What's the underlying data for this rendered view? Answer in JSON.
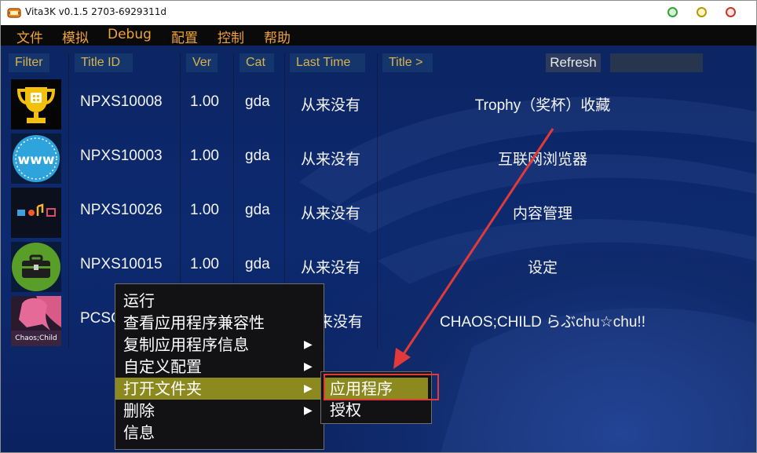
{
  "window": {
    "title": "Vita3K v0.1.5 2703-6929311d"
  },
  "menu": [
    "文件",
    "模拟",
    "Debug",
    "配置",
    "控制",
    "帮助"
  ],
  "columns": {
    "filter": "Filter",
    "title_id": "Title ID",
    "ver": "Ver",
    "cat": "Cat",
    "last_time": "Last Time",
    "title": "Title >",
    "refresh": "Refresh"
  },
  "search": {
    "value": ""
  },
  "apps": [
    {
      "icon": "trophy-icon",
      "title_id": "NPXS10008",
      "ver": "1.00",
      "cat": "gda",
      "last_time": "从来没有",
      "title": "Trophy（奖杯）收藏"
    },
    {
      "icon": "browser-icon",
      "title_id": "NPXS10003",
      "ver": "1.00",
      "cat": "gda",
      "last_time": "从来没有",
      "title": "互联网浏览器"
    },
    {
      "icon": "content-manager-icon",
      "title_id": "NPXS10026",
      "ver": "1.00",
      "cat": "gda",
      "last_time": "从来没有",
      "title": "内容管理"
    },
    {
      "icon": "settings-toolbox-icon",
      "title_id": "NPXS10015",
      "ver": "1.00",
      "cat": "gda",
      "last_time": "从来没有",
      "title": "设定"
    },
    {
      "icon": "game-cover-icon",
      "title_id": "PCSG",
      "ver": "",
      "cat": "",
      "last_time": "来没有",
      "title": "CHAOS;CHILD らぶchu☆chu!!"
    }
  ],
  "context_menu": {
    "items": [
      {
        "label": "运行",
        "submenu": false,
        "highlighted": false
      },
      {
        "label": "查看应用程序兼容性",
        "submenu": false,
        "highlighted": false
      },
      {
        "label": "复制应用程序信息",
        "submenu": true,
        "highlighted": false
      },
      {
        "label": "自定义配置",
        "submenu": true,
        "highlighted": false
      },
      {
        "label": "打开文件夹",
        "submenu": true,
        "highlighted": true
      },
      {
        "label": "删除",
        "submenu": true,
        "highlighted": false
      },
      {
        "label": "信息",
        "submenu": false,
        "highlighted": false
      }
    ],
    "arrow_glyph": "▶"
  },
  "submenu": {
    "items": [
      "应用程序",
      "授权"
    ]
  },
  "colors": {
    "menu_text": "#f0a338",
    "header_text": "#d9b24c",
    "highlight": "#8c8a1e",
    "annotation": "#e23a3a",
    "background": "#0d2a70"
  }
}
